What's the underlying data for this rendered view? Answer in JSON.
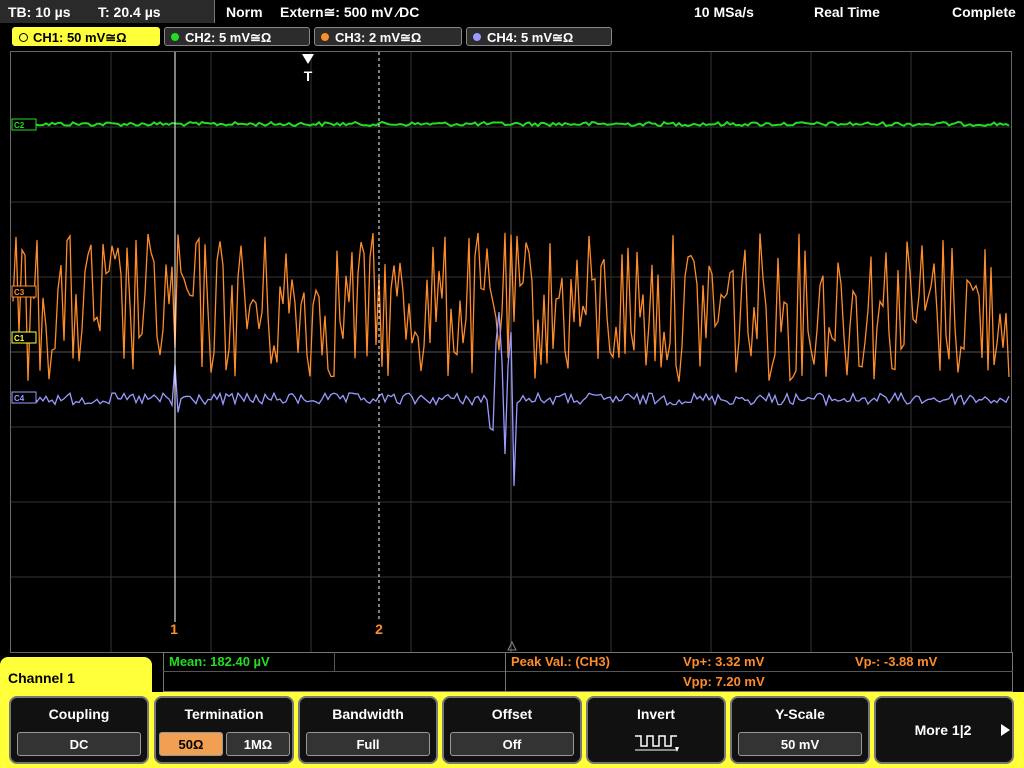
{
  "topbar": {
    "timebase": "TB: 10 µs",
    "trigger_pos": "T: 20.4 µs",
    "trigger_mode": "Norm",
    "trigger_source": "Extern≅: 500 mV ⁄DC",
    "sample_rate": "10 MSa/s",
    "acq_mode": "Real Time",
    "status": "Complete"
  },
  "channels": [
    {
      "label": "CH1: 50 mV≅Ω",
      "color": "#ffff3a",
      "active": true
    },
    {
      "label": "CH2: 5 mV≅Ω",
      "color": "#22dd22",
      "active": false
    },
    {
      "label": "CH3: 2 mV≅Ω",
      "color": "#ff8c2a",
      "active": false
    },
    {
      "label": "CH4: 5 mV≅Ω",
      "color": "#9a9aff",
      "active": false
    }
  ],
  "screen": {
    "trigger_marker": "T",
    "cursor1_label": "1",
    "cursor2_label": "2",
    "ch2_marker": "C2",
    "ch3_marker": "C3",
    "ch1_marker": "C1",
    "ch4_marker": "C4"
  },
  "measurements": {
    "mean": "Mean: 182.40 µV",
    "peak_title": "Peak Val.:  (CH3)",
    "vp_plus": "Vp+: 3.32 mV",
    "vp_minus": "Vp-: -3.88 mV",
    "vpp": "Vpp: 7.20 mV"
  },
  "panel_title": "Channel 1",
  "softkeys": {
    "coupling": {
      "title": "Coupling",
      "value": "DC"
    },
    "termination": {
      "title": "Termination",
      "opt1": "50Ω",
      "opt2": "1MΩ"
    },
    "bandwidth": {
      "title": "Bandwidth",
      "value": "Full"
    },
    "offset": {
      "title": "Offset",
      "value": "Off"
    },
    "invert": {
      "title": "Invert"
    },
    "yscale": {
      "title": "Y-Scale",
      "value": "50 mV"
    },
    "more": {
      "label": "More 1|2"
    }
  },
  "colors": {
    "ch1": "#ffff3a",
    "ch2": "#22dd22",
    "ch3": "#ff8c2a",
    "ch4": "#9a9aff",
    "grid": "#3a3a3a"
  }
}
